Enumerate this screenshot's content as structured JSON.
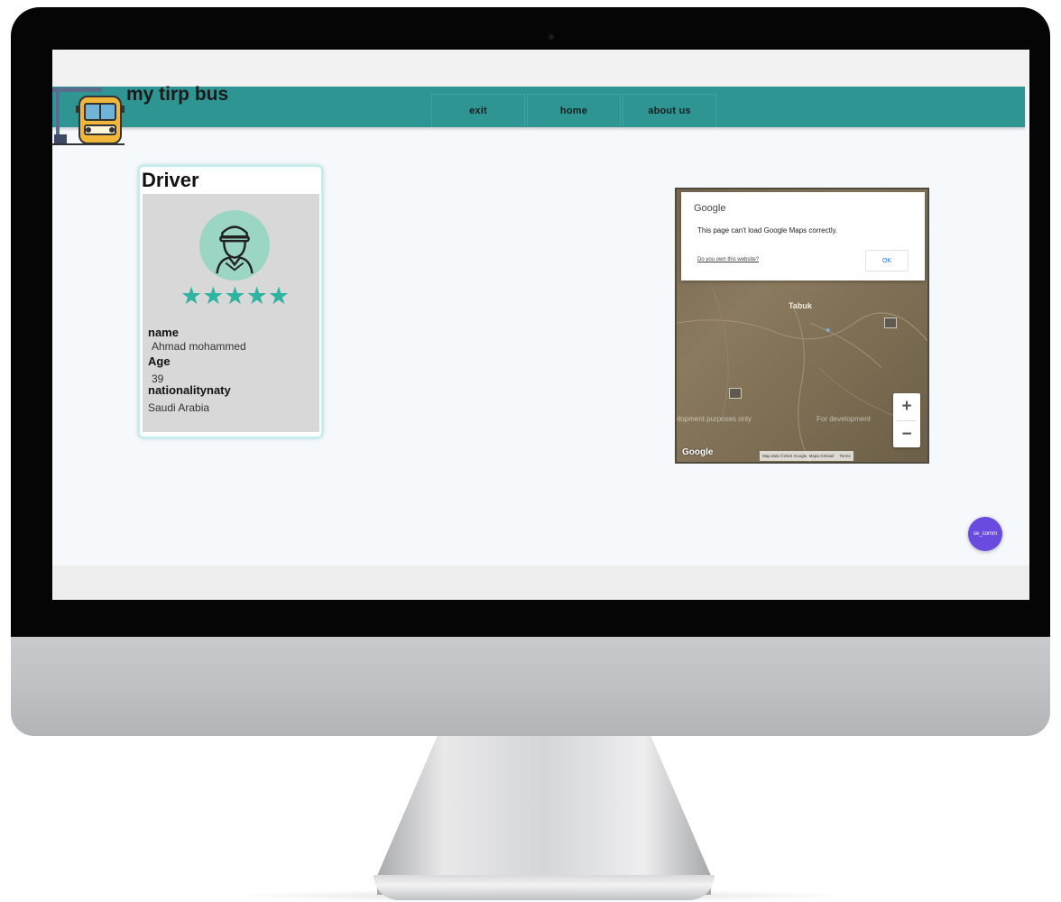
{
  "site": {
    "title": "my tirp bus"
  },
  "nav": {
    "items": [
      "exit",
      "home",
      "about us"
    ]
  },
  "driver": {
    "heading": "Driver",
    "rating": 5,
    "stars": "★★★★★",
    "name_label": "name",
    "name_value": "Ahmad mohammed",
    "age_label": "Age",
    "age_value": "39",
    "nationality_label": "nationalitynaty",
    "nationality_value": "Saudi Arabia"
  },
  "map": {
    "dialog_brand": "Google",
    "dialog_message": "This page can't load Google Maps correctly.",
    "dialog_link": "Do you own this website?",
    "dialog_ok": "OK",
    "main_town": "Tabuk",
    "watermark_left": "velopment purposes only",
    "watermark_right": "For development",
    "zoom_in": "+",
    "zoom_out": "−",
    "google_logo": "Google",
    "attribution": "Map data ©2024 Google, Mapa GISrael",
    "terms": "Terms"
  },
  "fab": {
    "label": "se_comm"
  },
  "colors": {
    "navbar": "#2e9593",
    "stars": "#2eb4a0",
    "fab": "#6a4be0"
  }
}
